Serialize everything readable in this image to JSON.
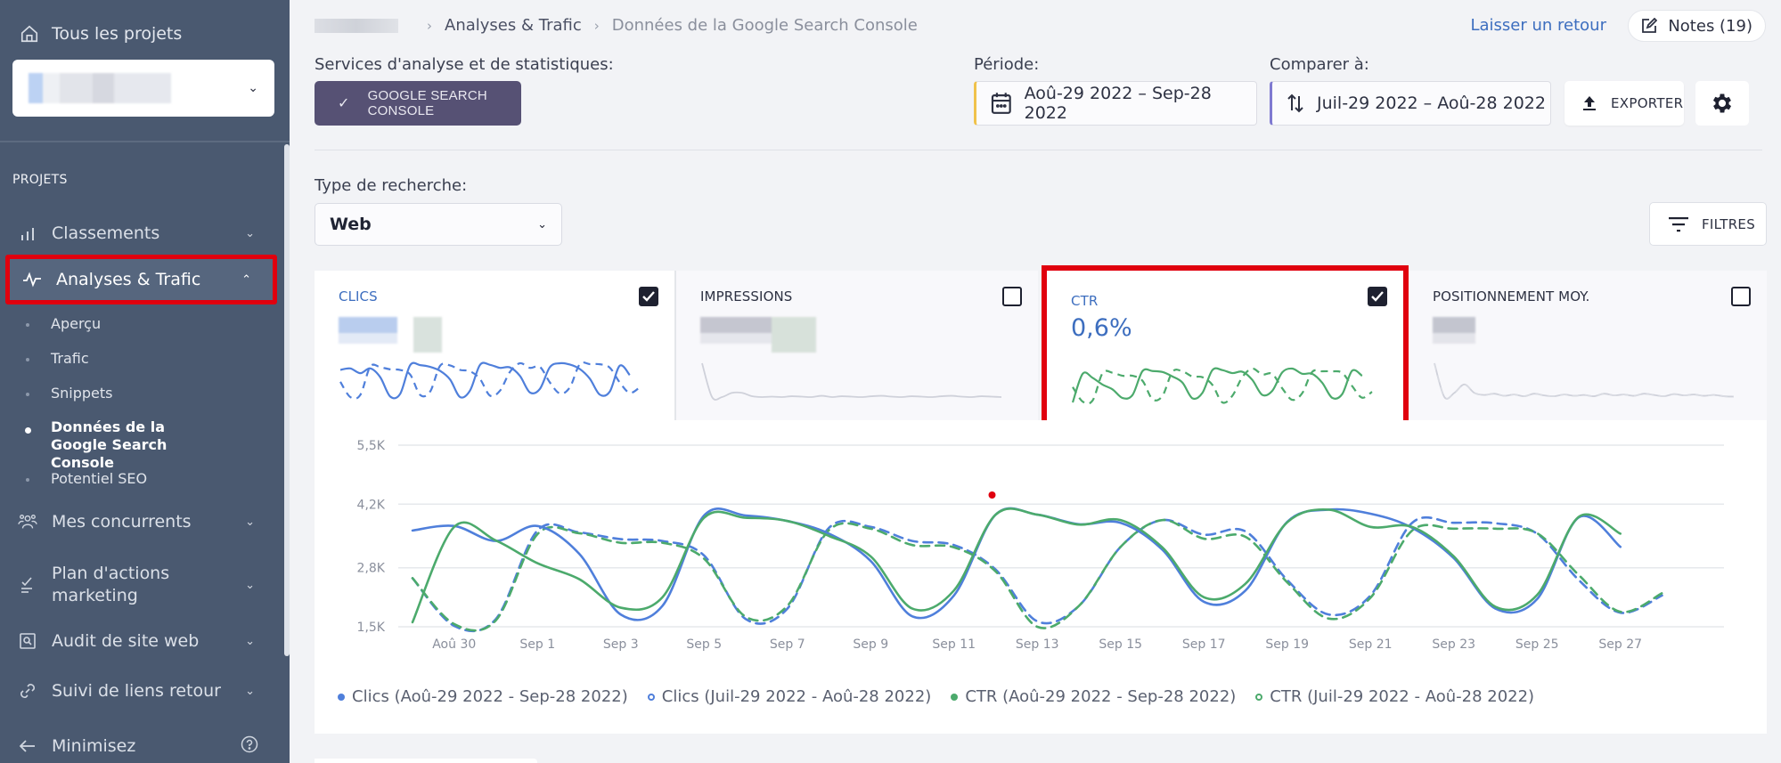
{
  "sidebar": {
    "all_projects": "Tous les projets",
    "project_select": {
      "value_redacted": true
    },
    "section_label": "PROJETS",
    "items": [
      {
        "label": "Classements",
        "icon": "bar-chart-icon",
        "expanded": false
      },
      {
        "label": "Analyses & Trafic",
        "icon": "pulse-icon",
        "expanded": true,
        "active": true
      },
      {
        "label": "Mes concurrents",
        "icon": "users-icon",
        "expanded": false
      },
      {
        "label": "Plan d'actions marketing",
        "icon": "checklist-icon",
        "expanded": false
      },
      {
        "label": "Audit de site web",
        "icon": "search-page-icon",
        "expanded": false
      },
      {
        "label": "Suivi de liens retour",
        "icon": "link-icon",
        "expanded": false
      }
    ],
    "sub_items": [
      {
        "label": "Aperçu"
      },
      {
        "label": "Trafic"
      },
      {
        "label": "Snippets"
      },
      {
        "label": "Données de la Google Search Console",
        "active": true
      },
      {
        "label": "Potentiel SEO"
      }
    ],
    "minimize": "Minimisez",
    "help_icon": "question-circle-icon"
  },
  "header": {
    "breadcrumb": [
      "Analyses & Trafic",
      "Données de la Google Search Console"
    ],
    "feedback_link": "Laisser un retour",
    "notes_button": "Notes (19)"
  },
  "controls": {
    "services_label": "Services d'analyse et de statistiques:",
    "gsc_button": "GOOGLE SEARCH CONSOLE",
    "period_label": "Période:",
    "period_value": "Aoû-29 2022 – Sep-28 2022",
    "compare_label": "Comparer à:",
    "compare_value": "Juil-29 2022 – Aoû-28 2022",
    "export_button": "EXPORTER",
    "search_type_label": "Type de recherche:",
    "search_type_value": "Web",
    "filters_button": "FILTRES"
  },
  "colors": {
    "clics": "#4f7fdb",
    "ctr": "#4caa6c",
    "highlight": "#e0000e",
    "period_accent": "#f0c24b",
    "compare_accent": "#7f7ad1"
  },
  "metrics": [
    {
      "title": "CLICS",
      "checked": true,
      "value_redacted": true
    },
    {
      "title": "IMPRESSIONS",
      "checked": false,
      "value_redacted": true
    },
    {
      "title": "CTR",
      "checked": true,
      "value": "0,6%"
    },
    {
      "title": "POSITIONNEMENT MOY.",
      "checked": false,
      "value_redacted": true
    }
  ],
  "chart_data": {
    "type": "line",
    "title": "",
    "xlabel": "",
    "ylabel": "",
    "ylim": [
      1500,
      5500
    ],
    "yticks": [
      "1,5K",
      "2,8K",
      "4,2K",
      "5,5K"
    ],
    "ytick_values": [
      1500,
      2800,
      4200,
      5500
    ],
    "x": [
      "Aoû 29",
      "Aoû 30",
      "Aoû 31",
      "Sep 1",
      "Sep 2",
      "Sep 3",
      "Sep 4",
      "Sep 5",
      "Sep 6",
      "Sep 7",
      "Sep 8",
      "Sep 9",
      "Sep 10",
      "Sep 11",
      "Sep 12",
      "Sep 13",
      "Sep 14",
      "Sep 15",
      "Sep 16",
      "Sep 17",
      "Sep 18",
      "Sep 19",
      "Sep 20",
      "Sep 21",
      "Sep 22",
      "Sep 23",
      "Sep 24",
      "Sep 25",
      "Sep 26",
      "Sep 27",
      "Sep 28"
    ],
    "xtick_labels": [
      "Aoû 30",
      "Sep 1",
      "Sep 3",
      "Sep 5",
      "Sep 7",
      "Sep 9",
      "Sep 11",
      "Sep 13",
      "Sep 15",
      "Sep 17",
      "Sep 19",
      "Sep 21",
      "Sep 23",
      "Sep 25",
      "Sep 27"
    ],
    "grid": true,
    "legend_position": "bottom-left",
    "series": [
      {
        "name": "Clics (Aoû-29 2022 - Sep-28 2022)",
        "color": "#4f7fdb",
        "style": "solid",
        "values": [
          3620,
          3720,
          3390,
          3720,
          3110,
          1770,
          1960,
          3950,
          3950,
          3830,
          3550,
          2950,
          1730,
          2190,
          3970,
          3970,
          3760,
          3790,
          3200,
          2050,
          2300,
          3810,
          4080,
          3990,
          3680,
          3010,
          1900,
          2110,
          3910,
          3260,
          null
        ]
      },
      {
        "name": "Clics (Juil-29 2022 - Aoû-28 2022)",
        "color": "#4f7fdb",
        "style": "dashed",
        "values": [
          2570,
          1520,
          1670,
          3620,
          3580,
          3430,
          3390,
          3070,
          1670,
          1900,
          3680,
          3700,
          3390,
          3300,
          2760,
          1620,
          1960,
          3260,
          3850,
          3530,
          3600,
          2530,
          1770,
          2190,
          3790,
          3790,
          3780,
          3550,
          2530,
          1810,
          2190
        ]
      },
      {
        "name": "CTR (Aoû-29 2022 - Sep-28 2022)",
        "color": "#4caa6c",
        "style": "solid",
        "values": [
          1600,
          3700,
          3400,
          2900,
          2550,
          1920,
          2150,
          3900,
          3900,
          3830,
          3500,
          3050,
          1900,
          2300,
          3970,
          3970,
          3750,
          3850,
          3250,
          2150,
          2450,
          3800,
          4080,
          3700,
          3700,
          3050,
          1940,
          2200,
          3920,
          3550,
          null
        ]
      },
      {
        "name": "CTR (Juil-29 2022 - Aoû-28 2022)",
        "color": "#4caa6c",
        "style": "dashed",
        "values": [
          2570,
          1560,
          1640,
          3540,
          3560,
          3350,
          3350,
          3000,
          1720,
          1960,
          3630,
          3660,
          3300,
          3250,
          2720,
          1500,
          1960,
          3260,
          3850,
          3440,
          3480,
          2480,
          1680,
          2140,
          3620,
          3660,
          3660,
          3560,
          2640,
          1830,
          2240
        ]
      }
    ],
    "annotation": {
      "date": "Sep 12",
      "type": "note-marker",
      "color": "#e0000e"
    }
  }
}
